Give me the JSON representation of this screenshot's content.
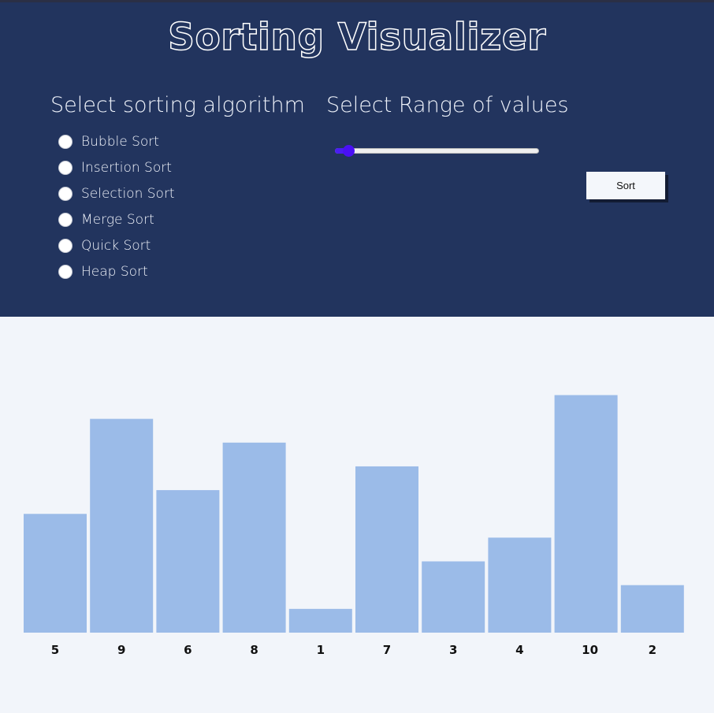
{
  "header": {
    "title": "Sorting Visualizer",
    "algorithm_heading": "Select sorting algorithm",
    "range_heading": "Select Range of values"
  },
  "algorithms": [
    {
      "label": "Bubble Sort",
      "selected": false
    },
    {
      "label": "Insertion Sort",
      "selected": false
    },
    {
      "label": "Selection Sort",
      "selected": false
    },
    {
      "label": "Merge Sort",
      "selected": false
    },
    {
      "label": "Quick Sort",
      "selected": false
    },
    {
      "label": "Heap Sort",
      "selected": false
    }
  ],
  "range_slider": {
    "level": 0.04
  },
  "sort_button": {
    "label": "Sort"
  },
  "colors": {
    "header_bg": "#22345e",
    "body_bg": "#f2f5fa",
    "bar": "#9bbbe8",
    "slider_accent": "#4a10f5"
  },
  "chart_data": {
    "type": "bar",
    "categories": [
      "5",
      "9",
      "6",
      "8",
      "1",
      "7",
      "3",
      "4",
      "10",
      "2"
    ],
    "values": [
      5,
      9,
      6,
      8,
      1,
      7,
      3,
      4,
      10,
      2
    ],
    "title": "",
    "xlabel": "",
    "ylabel": "",
    "ylim": [
      0,
      10
    ],
    "grid": false
  }
}
